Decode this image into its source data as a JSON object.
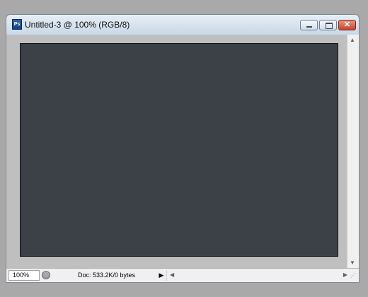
{
  "window": {
    "app_icon_label": "Ps",
    "title": "Untitled-3 @ 100% (RGB/8)",
    "controls": {
      "minimize_icon": "minimize-icon",
      "maximize_icon": "maximize-icon",
      "close_icon": "close-icon",
      "close_glyph": "✕"
    }
  },
  "canvas": {
    "color": "#3c4047"
  },
  "status_bar": {
    "zoom": "100%",
    "doc_info": "Doc: 533.2K/0 bytes",
    "menu_arrow": "▶"
  },
  "scrollbars": {
    "up_arrow": "▲",
    "down_arrow": "▼",
    "left_arrow": "◀",
    "right_arrow": "▶"
  }
}
